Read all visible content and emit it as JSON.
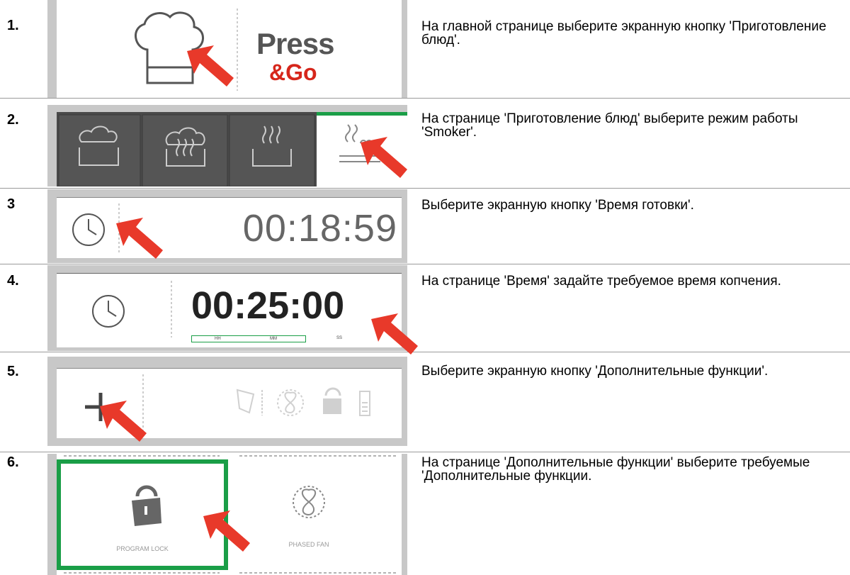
{
  "steps": [
    {
      "number": "1.",
      "text": "На главной странице выберите экранную кнопку 'Приготовление блюд'.",
      "panel": {
        "press": "Press",
        "go": "&Go"
      }
    },
    {
      "number": "2.",
      "text": "На странице 'Приготовление блюд' выберите режим работы 'Smoker'."
    },
    {
      "number": "3",
      "text": "Выберите экранную кнопку 'Время готовки'.",
      "panel": {
        "time": "00:18:59"
      }
    },
    {
      "number": "4.",
      "text": "На странице 'Время' задайте требуемое время копчения.",
      "panel": {
        "time": "00:25:00",
        "hh": "HH",
        "mm": "MM",
        "ss": "SS"
      }
    },
    {
      "number": "5.",
      "text": "Выберите экранную кнопку 'Дополнительные функции'."
    },
    {
      "number": "6.",
      "text": "На странице 'Дополнительные функции' выбе­рите требуемые 'Дополнительные функции.",
      "panel": {
        "lock_label": "PROGRAM LOCK",
        "fan_label": "PHASED FAN"
      }
    }
  ],
  "colors": {
    "arrow": "#e8392a",
    "brand_red": "#d6261b",
    "green": "#1a9e47",
    "dark_tile": "#4a4a4a",
    "panel_gray": "#c8c8c8"
  }
}
